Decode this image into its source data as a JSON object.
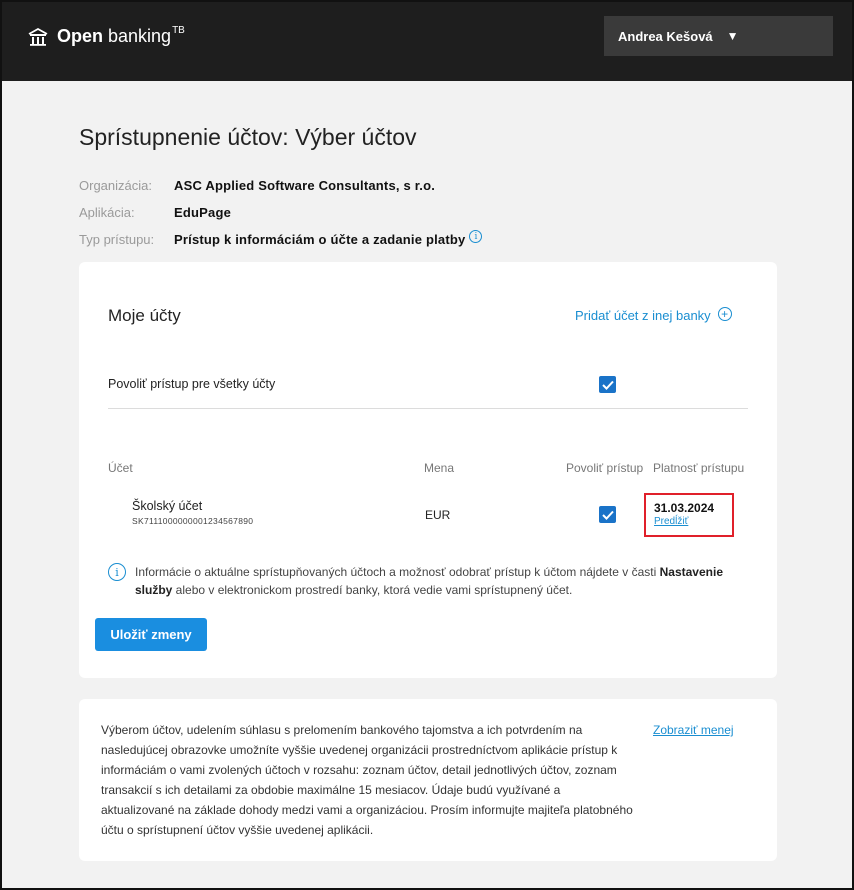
{
  "header": {
    "brand_bold": "Open",
    "brand_rest": "banking",
    "brand_sup": "TB",
    "user_name": "Andrea Kešová",
    "user_caret": "▼"
  },
  "page": {
    "title": "Sprístupnenie účtov: Výber účtov"
  },
  "meta": [
    {
      "key": "Organizácia:",
      "value": "ASC Applied Software Consultants, s r.o."
    },
    {
      "key": "Aplikácia:",
      "value": "EduPage"
    },
    {
      "key": "Typ prístupu:",
      "value": "Prístup k informáciám o účte a zadanie platby"
    }
  ],
  "accounts_card": {
    "title": "Moje účty",
    "add_link": "Pridať účet z inej banky",
    "allow_all_label": "Povoliť prístup pre všetky účty",
    "allow_all_checked": true,
    "columns": {
      "account": "Účet",
      "currency": "Mena",
      "allow": "Povoliť prístup",
      "validity": "Platnosť prístupu"
    },
    "rows": [
      {
        "name": "Školský účet",
        "iban": "SK7111000000001234567890",
        "currency": "EUR",
        "allowed": true,
        "valid_until": "31.03.2024",
        "extend_label": "Predĺžiť"
      }
    ],
    "notice_before": "Informácie o aktuálne sprístupňovaných účtoch a možnosť odobrať prístup k účtom nájdete v časti ",
    "notice_bold": "Nastavenie služby",
    "notice_after": " alebo v elektronickom prostredí banky, ktorá vedie vami sprístupnený účet.",
    "save_label": "Uložiť zmeny"
  },
  "consent_card": {
    "text": "Výberom účtov, udelením súhlasu s prelomením bankového tajomstva a ich potvrdením na nasledujúcej obrazovke umožníte vyššie uvedenej organizácii prostredníctvom aplikácie prístup k informáciám o vami zvolených účtoch v rozsahu: zoznam účtov, detail jednotlivých účtov, zoznam transakcií s ich detailami za obdobie maximálne 15 mesiacov. Údaje budú využívané a aktualizované na základe dohody medzi vami a organizáciou. Prosím informujte majiteľa platobného účtu o sprístupnení účtov vyššie uvedenej aplikácii.",
    "show_less": "Zobraziť menej"
  },
  "colors": {
    "accent": "#1a8ed1",
    "button": "#1a8ee0",
    "checkbox": "#1a73c8",
    "highlight": "#e0202a",
    "topbar": "#1e1e1e"
  }
}
